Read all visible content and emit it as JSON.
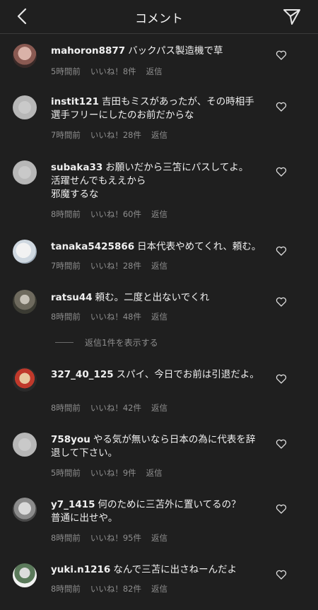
{
  "header": {
    "title": "コメント"
  },
  "comments": [
    {
      "username": "mahoron8877",
      "text": "バックパス製造機で草",
      "time": "5時間前",
      "likes": "いいね！8件",
      "reply": "返信"
    },
    {
      "username": "instit121",
      "text": "吉田もミスがあったが、その時相手選手フリーにしたのお前だからな",
      "time": "7時間前",
      "likes": "いいね！28件",
      "reply": "返信"
    },
    {
      "username": "subaka33",
      "text": "お願いだから三笘にパスしてよ。\n活躍せんでもええから\n邪魔するな",
      "time": "8時間前",
      "likes": "いいね！60件",
      "reply": "返信"
    },
    {
      "username": "tanaka5425866",
      "text": "日本代表やめてくれ、頼む。",
      "time": "7時間前",
      "likes": "いいね！28件",
      "reply": "返信"
    },
    {
      "username": "ratsu44",
      "text": "頼む。二度と出ないでくれ",
      "time": "8時間前",
      "likes": "いいね！48件",
      "reply": "返信"
    },
    {
      "username": "327_40_125",
      "text": "スパイ、今日でお前は引退だよ。",
      "time": "8時間前",
      "likes": "いいね！42件",
      "reply": "返信"
    },
    {
      "username": "758you",
      "text": "やる気が無いなら日本の為に代表を辞退して下さい。",
      "time": "5時間前",
      "likes": "いいね！9件",
      "reply": "返信"
    },
    {
      "username": "y7_1415",
      "text": "何のために三苫外に置いてるの？\n普通に出せや。",
      "time": "8時間前",
      "likes": "いいね！95件",
      "reply": "返信"
    },
    {
      "username": "yuki.n1216",
      "text": "なんで三苫に出さねーんだよ",
      "time": "8時間前",
      "likes": "いいね！82件",
      "reply": "返信"
    }
  ],
  "view_replies": "返信1件を表示する"
}
